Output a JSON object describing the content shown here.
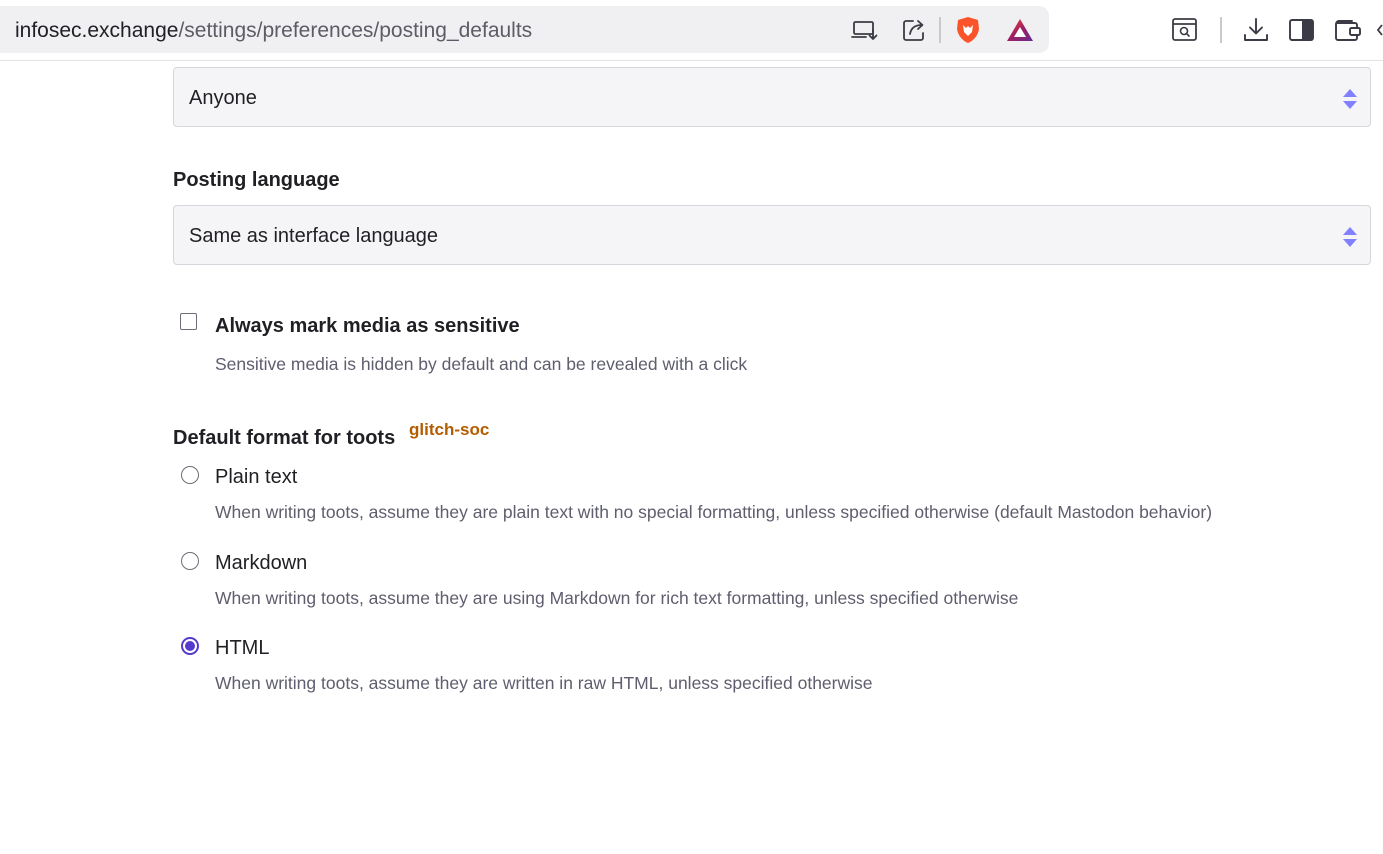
{
  "browser": {
    "url_host": "infosec.exchange",
    "url_path": "/settings/preferences/posting_defaults"
  },
  "settings": {
    "visibility_select": {
      "value": "Anyone"
    },
    "posting_language": {
      "label": "Posting language",
      "value": "Same as interface language"
    },
    "sensitive_media": {
      "label": "Always mark media as sensitive",
      "hint": "Sensitive media is hidden by default and can be revealed with a click",
      "checked": false
    },
    "default_format": {
      "label": "Default format for toots",
      "badge": "glitch-soc",
      "options": [
        {
          "label": "Plain text",
          "hint": "When writing toots, assume they are plain text with no special formatting, unless specified otherwise (default Mastodon behavior)",
          "checked": false
        },
        {
          "label": "Markdown",
          "hint": "When writing toots, assume they are using Markdown for rich text formatting, unless specified otherwise",
          "checked": false
        },
        {
          "label": "HTML",
          "hint": "When writing toots, assume they are written in raw HTML, unless specified otherwise",
          "checked": true
        }
      ]
    }
  },
  "colors": {
    "accent": "#563acc",
    "badge": "#b35c00",
    "brave_orange": "#fb542b"
  },
  "icons": [
    "install-app-icon",
    "share-icon",
    "brave-shields-icon",
    "brave-rewards-icon",
    "search-tab-icon",
    "download-icon",
    "sidebar-icon",
    "wallet-icon"
  ]
}
